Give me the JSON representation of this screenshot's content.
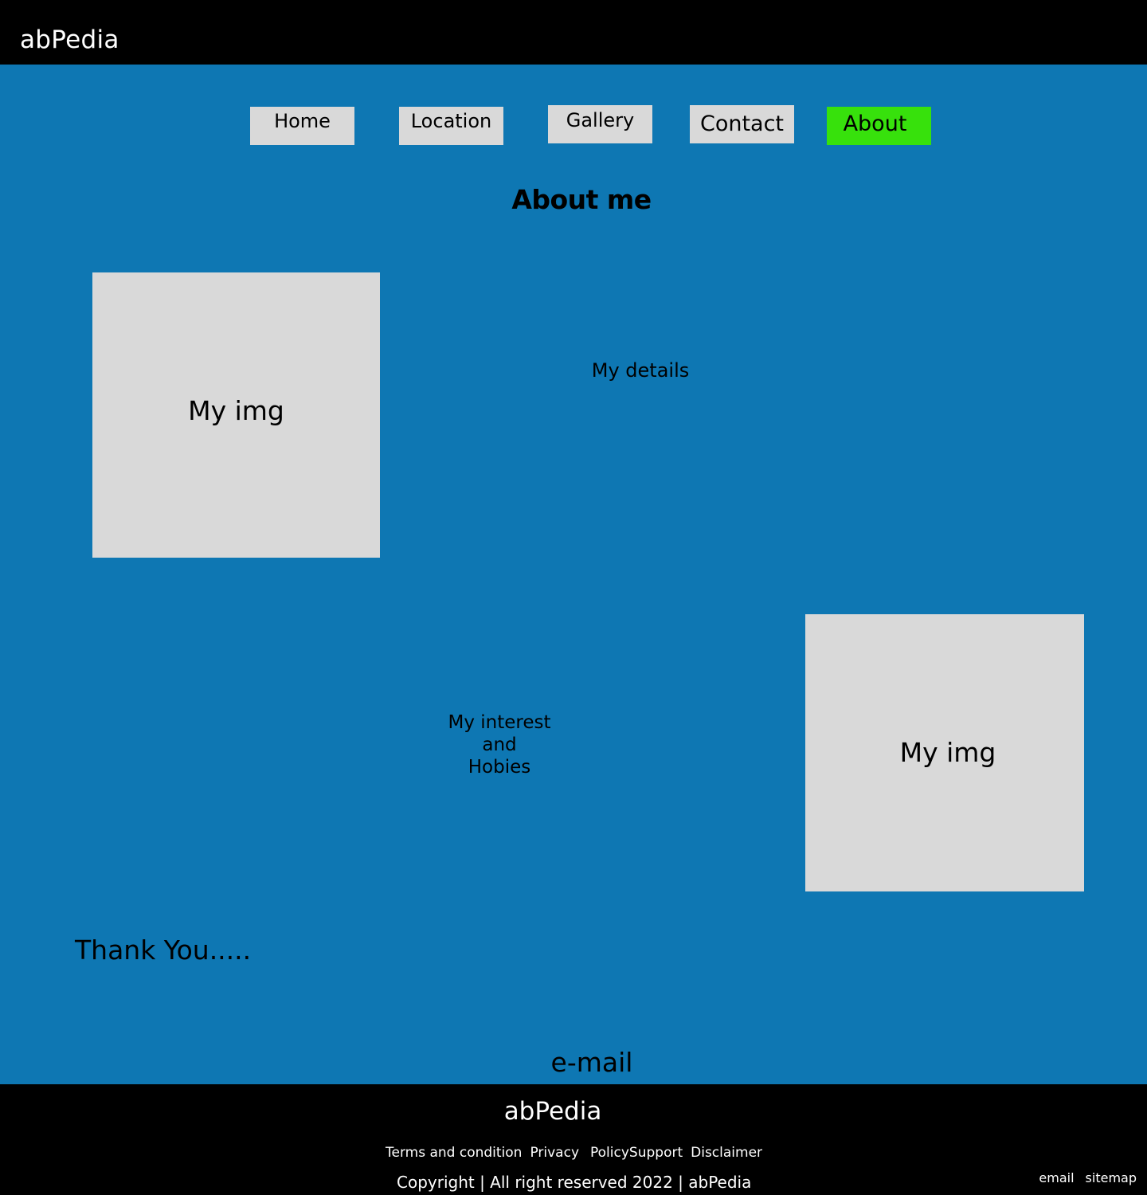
{
  "header": {
    "brand": "abPedia"
  },
  "nav": {
    "home": "Home",
    "location": "Location",
    "gallery": "Gallery",
    "contact": "Contact",
    "about": "About"
  },
  "main": {
    "title": "About me",
    "image_1_label": "My img",
    "details": "My details",
    "interests": [
      "My interest",
      "and",
      "Hobies"
    ],
    "image_2_label": "My img",
    "thanks": "Thank You.....",
    "email": "e-mail"
  },
  "footer": {
    "brand": "abPedia",
    "links": {
      "terms": "Terms and condition",
      "privacy": "Privacy",
      "policy_support": "PolicySupport",
      "disclaimer": "Disclaimer"
    },
    "copyright": "Copyright  | All right reserved 2022 | abPedia",
    "right_links": {
      "email": "email",
      "sitemap": "sitemap"
    }
  },
  "colors": {
    "header_bg": "#000000",
    "main_bg": "#0e77b3",
    "nav_button_bg": "#d9d9d9",
    "nav_active_bg": "#37e10c",
    "placeholder_bg": "#d9d9d9",
    "footer_bg": "#000000"
  }
}
